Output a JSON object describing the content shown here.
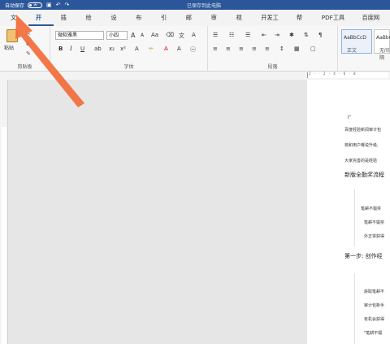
{
  "titlebar": {
    "autosave_label": "自动保存",
    "toggle_state": "关",
    "doc_title": "已保存到此电脑"
  },
  "menu": {
    "items": [
      "文件",
      "开始",
      "插入",
      "绘图",
      "设计",
      "布局",
      "引用",
      "邮件",
      "审阅",
      "视图",
      "开发工具",
      "帮助",
      "PDF工具集",
      "百度网盘"
    ]
  },
  "ribbon": {
    "clipboard": {
      "paste_label": "粘贴",
      "group_label": "剪贴板"
    },
    "font": {
      "name": "微软雅黑",
      "size": "小四",
      "grow": "A",
      "shrink": "A",
      "case": "Aa",
      "bold": "B",
      "italic": "I",
      "underline": "U",
      "group_label": "字体"
    },
    "paragraph": {
      "group_label": "段落"
    },
    "styles": {
      "sample": "AaBbCcD",
      "style1": "正文",
      "style2": "无间隔"
    }
  },
  "document": {
    "line1": "百度经验新闻审计包",
    "line2": "核和用户曝说升级,",
    "line3": "大家完善的是经验",
    "heading1": "新版全勤奖流程",
    "q1": "笔耕不辍奖",
    "q2": "笔耕不辍奖",
    "q3": "外正将获得",
    "heading2": "第一步: 创作经",
    "q4": "获取笔耕不",
    "q5": "审计包新手",
    "q6": "有机会获得",
    "q7": "\"笔耕不辍"
  },
  "colors": {
    "titlebar": "#2b579a",
    "accent": "#2b579a",
    "arrow": "#f26b3a"
  }
}
